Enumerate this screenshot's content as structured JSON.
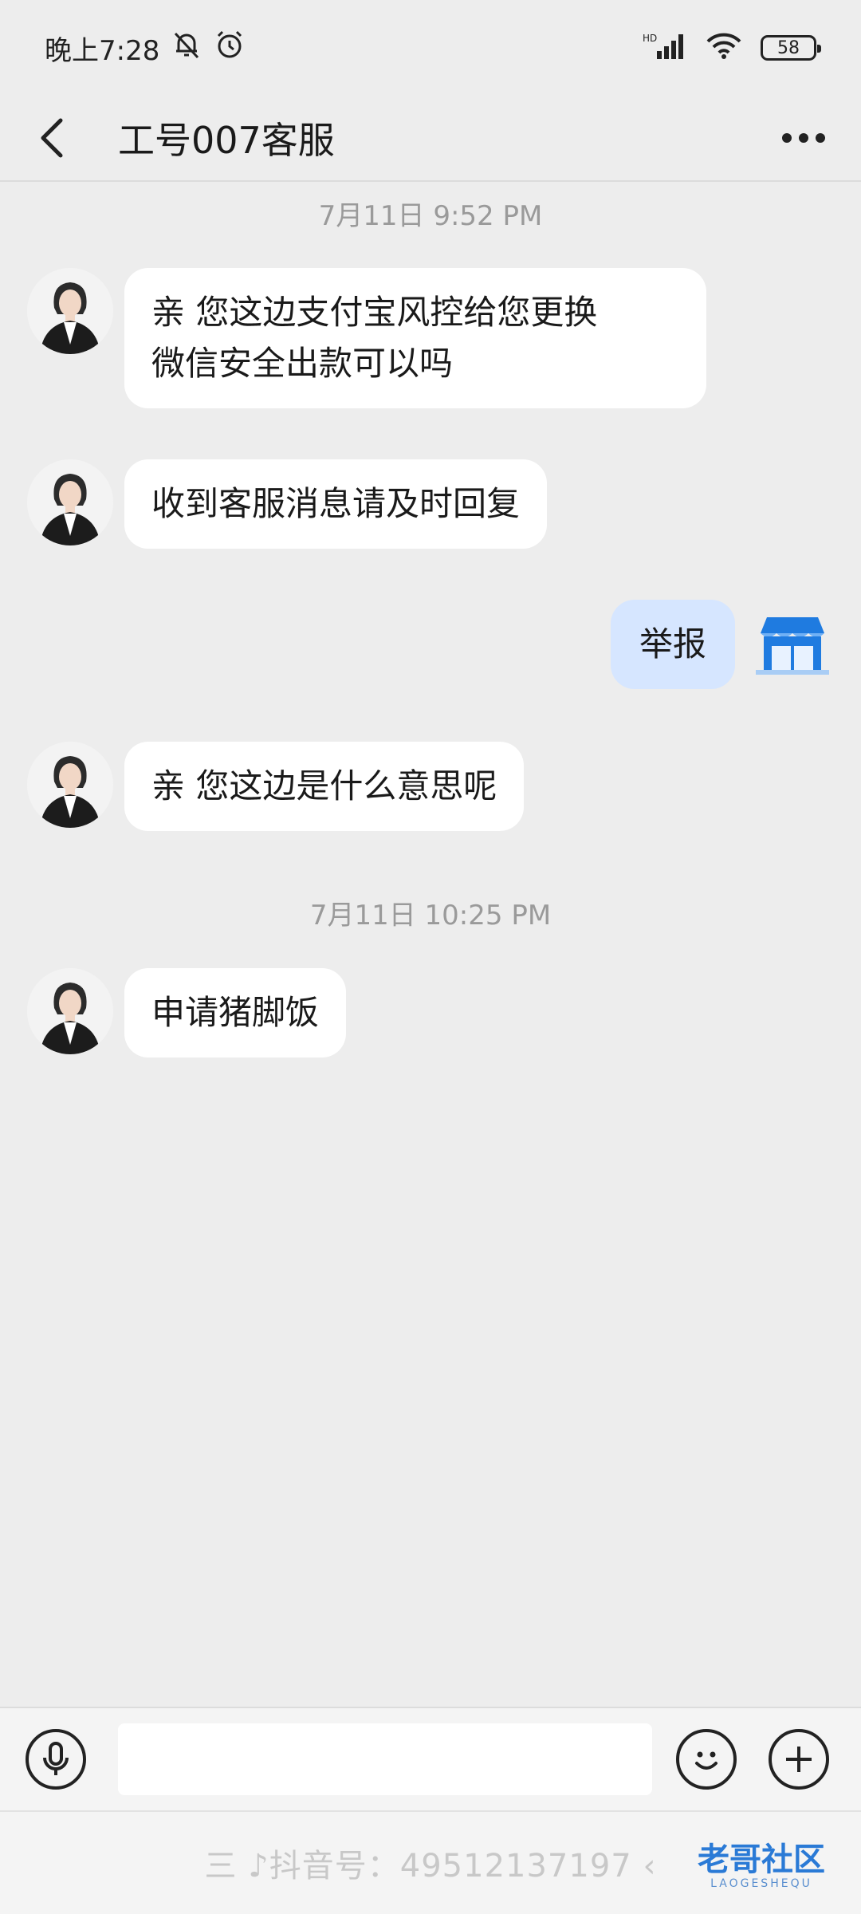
{
  "status_bar": {
    "time": "晚上7:28",
    "network": "HD",
    "battery": "58"
  },
  "header": {
    "title": "工号007客服"
  },
  "conversation": [
    {
      "type": "timestamp",
      "text": "7月11日 9:52 PM"
    },
    {
      "type": "incoming",
      "text": "亲 您这边支付宝风控给您更换\n微信安全出款可以吗"
    },
    {
      "type": "incoming",
      "text": "收到客服消息请及时回复"
    },
    {
      "type": "outgoing",
      "text": "举报"
    },
    {
      "type": "incoming",
      "text": "亲 您这边是什么意思呢"
    },
    {
      "type": "timestamp",
      "text": "7月11日 10:25 PM"
    },
    {
      "type": "incoming",
      "text": "申请猪脚饭"
    }
  ],
  "input_bar": {
    "value": ""
  },
  "watermark": {
    "text": "三 ♪抖音号：49512137197 ‹",
    "logo": "老哥社区",
    "logo_sub": "LAOGESHEQU"
  },
  "colors": {
    "background": "#ededed",
    "incoming_bubble": "#ffffff",
    "outgoing_bubble": "#d6e6ff",
    "shop_icon": "#1f7be0"
  }
}
